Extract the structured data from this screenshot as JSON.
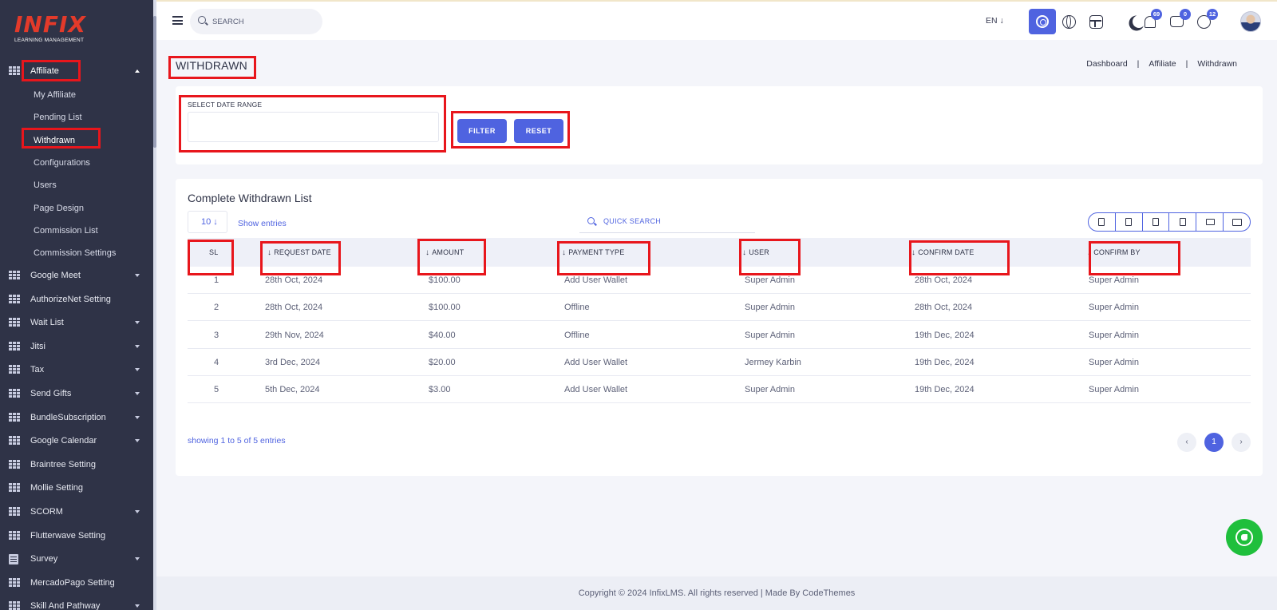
{
  "brand": {
    "logo_text": "INFIX",
    "logo_sub": "LEARNING MANAGEMENT"
  },
  "sidebar": {
    "section": {
      "label": "Affiliate",
      "icon": "grid-icon"
    },
    "sub_items": [
      {
        "label": "My Affiliate",
        "active": false
      },
      {
        "label": "Pending List",
        "active": false
      },
      {
        "label": "Withdrawn",
        "active": true
      },
      {
        "label": "Configurations",
        "active": false
      },
      {
        "label": "Users",
        "active": false
      },
      {
        "label": "Page Design",
        "active": false
      },
      {
        "label": "Commission List",
        "active": false
      },
      {
        "label": "Commission Settings",
        "active": false
      }
    ],
    "items": [
      {
        "label": "Google Meet",
        "has_caret": true,
        "icon": "grid-icon"
      },
      {
        "label": "AuthorizeNet Setting",
        "has_caret": false,
        "icon": "grid-icon"
      },
      {
        "label": "Wait List",
        "has_caret": true,
        "icon": "grid-icon"
      },
      {
        "label": "Jitsi",
        "has_caret": true,
        "icon": "grid-icon"
      },
      {
        "label": "Tax",
        "has_caret": true,
        "icon": "grid-icon"
      },
      {
        "label": "Send Gifts",
        "has_caret": true,
        "icon": "grid-icon"
      },
      {
        "label": "BundleSubscription",
        "has_caret": true,
        "icon": "grid-icon"
      },
      {
        "label": "Google Calendar",
        "has_caret": true,
        "icon": "grid-icon"
      },
      {
        "label": "Braintree Setting",
        "has_caret": false,
        "icon": "grid-icon"
      },
      {
        "label": "Mollie Setting",
        "has_caret": false,
        "icon": "grid-icon"
      },
      {
        "label": "SCORM",
        "has_caret": true,
        "icon": "grid-icon"
      },
      {
        "label": "Flutterwave Setting",
        "has_caret": false,
        "icon": "grid-icon"
      },
      {
        "label": "Survey",
        "has_caret": true,
        "icon": "doc-icon"
      },
      {
        "label": "MercadoPago Setting",
        "has_caret": false,
        "icon": "grid-icon"
      },
      {
        "label": "Skill And Pathway",
        "has_caret": true,
        "icon": "grid-icon"
      }
    ]
  },
  "header": {
    "search_placeholder": "SEARCH",
    "language": "EN ↓",
    "badges": {
      "notifications": "69",
      "messages": "0",
      "whatsapp": "12"
    },
    "accent": "#4f63e0"
  },
  "page": {
    "title": "WITHDRAWN",
    "breadcrumb": [
      "Dashboard",
      "Affiliate",
      "Withdrawn"
    ]
  },
  "filter": {
    "date_label": "SELECT DATE RANGE",
    "date_value": "",
    "filter_button": "FILTER",
    "reset_button": "RESET"
  },
  "table": {
    "title": "Complete Withdrawn List",
    "page_size": "10 ↓",
    "show_entries": "Show entries",
    "quick_search": "QUICK SEARCH",
    "export_icons": [
      "copy-icon",
      "csv-icon",
      "excel-icon",
      "pdf-icon",
      "print-icon",
      "column-visibility-icon"
    ],
    "columns": [
      "SL",
      "REQUEST DATE",
      "AMOUNT",
      "PAYMENT TYPE",
      "USER",
      "CONFIRM DATE",
      "CONFIRM BY"
    ],
    "rows": [
      [
        "1",
        "28th Oct, 2024",
        "$100.00",
        "Add User Wallet",
        "Super Admin",
        "28th Oct, 2024",
        "Super Admin"
      ],
      [
        "2",
        "28th Oct, 2024",
        "$100.00",
        "Offline",
        "Super Admin",
        "28th Oct, 2024",
        "Super Admin"
      ],
      [
        "3",
        "29th Nov, 2024",
        "$40.00",
        "Offline",
        "Super Admin",
        "19th Dec, 2024",
        "Super Admin"
      ],
      [
        "4",
        "3rd Dec, 2024",
        "$20.00",
        "Add User Wallet",
        "Jermey Karbin",
        "19th Dec, 2024",
        "Super Admin"
      ],
      [
        "5",
        "5th Dec, 2024",
        "$3.00",
        "Add User Wallet",
        "Super Admin",
        "19th Dec, 2024",
        "Super Admin"
      ]
    ],
    "showing": "showing 1 to 5 of 5 entries",
    "pagination": {
      "prev": "‹",
      "current": "1",
      "next": "›"
    }
  },
  "footer": {
    "text": "Copyright © 2024 InfixLMS. All rights reserved | Made By CodeThemes"
  }
}
